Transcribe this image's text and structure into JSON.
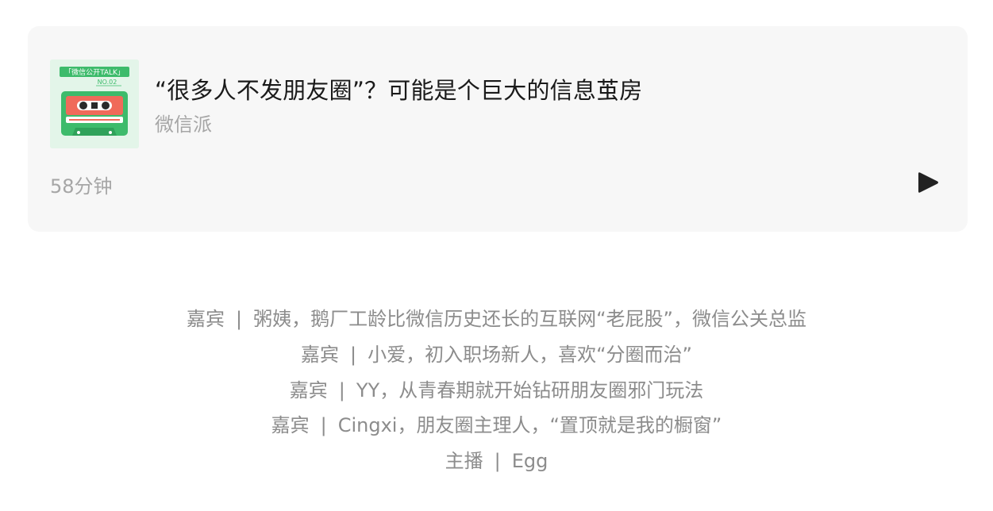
{
  "audio_card": {
    "title": "“很多人不发朋友圈”？可能是个巨大的信息茧房",
    "author": "微信派",
    "duration": "58分钟",
    "play_icon": "play-icon",
    "cover": {
      "badge_text": "「微信公开TALK」",
      "episode_text": "NO.02",
      "background_color": "#dff3e6",
      "tape_color": "#3dbb6b",
      "label_color": "#f06a5a"
    }
  },
  "credits": [
    {
      "role": "嘉宾",
      "separator": "|",
      "desc": "粥姨，鹅厂工龄比微信历史还长的互联网“老屁股”，微信公关总监"
    },
    {
      "role": "嘉宾",
      "separator": "|",
      "desc": "小爱，初入职场新人，喜欢“分圈而治”"
    },
    {
      "role": "嘉宾",
      "separator": "|",
      "desc": "YY，从青春期就开始钻研朋友圈邪门玩法"
    },
    {
      "role": "嘉宾",
      "separator": "|",
      "desc": "Cingxi，朋友圈主理人，“置顶就是我的橱窗”"
    },
    {
      "role": "主播",
      "separator": "|",
      "desc": "Egg"
    }
  ]
}
